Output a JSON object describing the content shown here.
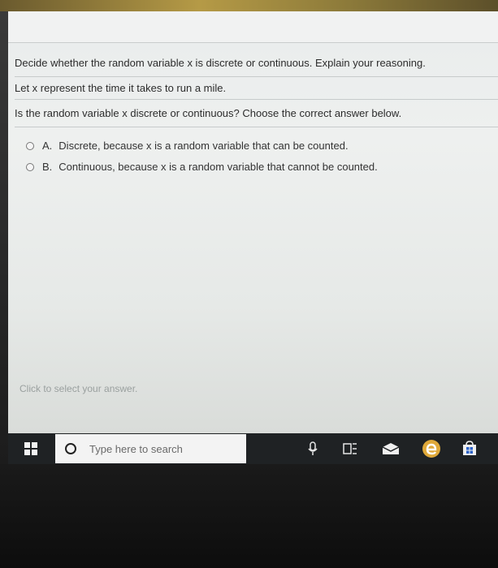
{
  "question": {
    "prompt": "Decide whether the random variable x is discrete or continuous. Explain your reasoning.",
    "context": "Let x represent the time it takes to run a mile.",
    "ask": "Is the random variable x discrete or continuous? Choose the correct answer below.",
    "options": [
      {
        "letter": "A.",
        "text": "Discrete, because x is a random variable that can be counted."
      },
      {
        "letter": "B.",
        "text": "Continuous, because x is a random variable that cannot be counted."
      }
    ],
    "hint": "Click to select your answer."
  },
  "taskbar": {
    "search_placeholder": "Type here to search",
    "icons": [
      "windows-start-icon",
      "search-circle-icon",
      "microphone-icon",
      "task-view-icon",
      "mail-icon",
      "edge-browser-icon",
      "store-icon"
    ]
  },
  "colors": {
    "taskbar": "#1f2224",
    "edge": "#e0a93a",
    "store": "#2d63c8"
  }
}
